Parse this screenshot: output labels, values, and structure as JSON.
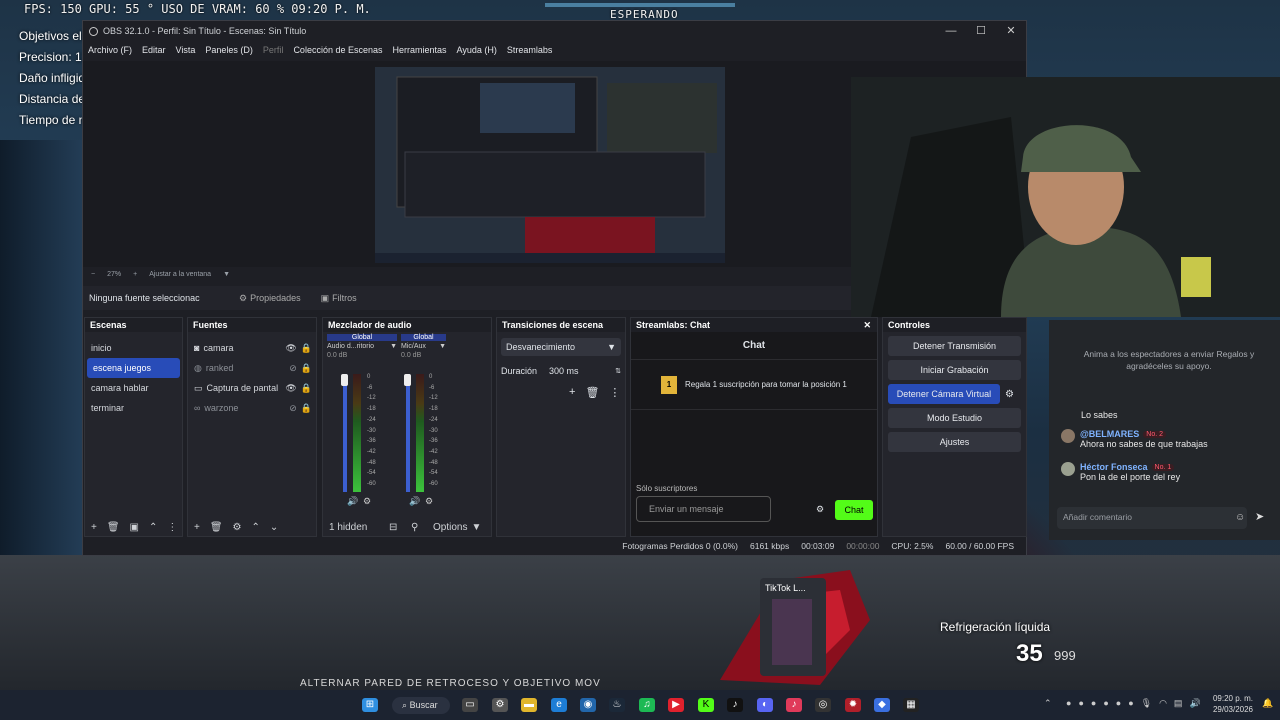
{
  "hud": {
    "stats": "FPS: 150  GPU: 55 °  USO DE VRAM: 60 %  09:20 P. M.",
    "status": "ESPERANDO",
    "objectives": [
      "Objetivos elin",
      "Precision: 13.",
      "Daño infligido",
      "Distancia del",
      "Tiempo de m"
    ],
    "weapon_label": "Refrigeración líquida",
    "ammo": "35",
    "ammo_reserve": "999",
    "hint": "ALTERNAR PARED DE RETROCESO Y OBJETIVO MÓVIL"
  },
  "obs": {
    "title": "OBS 32.1.0 - Perfil: Sin Título - Escenas: Sin Título",
    "menu": [
      "Archivo (F)",
      "Editar",
      "Vista",
      "Paneles (D)",
      "Perfil",
      "Colección de Escenas",
      "Herramientas",
      "Ayuda (H)",
      "Streamlabs"
    ],
    "zoom": "27%",
    "zoom_fit": "Ajustar a la ventana",
    "no_source": "Ninguna fuente seleccionac",
    "properties": "Propiedades",
    "filters": "Filtros",
    "scenes": {
      "title": "Escenas",
      "items": [
        "inicio",
        "escena juegos",
        "camara hablar",
        "terminar"
      ],
      "selected": 1
    },
    "sources": {
      "title": "Fuentes",
      "items": [
        {
          "label": "camara",
          "enabled": true
        },
        {
          "label": "ranked",
          "enabled": false
        },
        {
          "label": "Captura de pantal",
          "enabled": true
        },
        {
          "label": "warzone",
          "enabled": false
        }
      ]
    },
    "mixer": {
      "title": "Mezclador de audio",
      "channels": [
        {
          "label": "Global",
          "name": "Audio d...ritorio",
          "db": "0.0 dB"
        },
        {
          "label": "Global",
          "name": "Mic/Aux",
          "db": "0.0 dB"
        }
      ],
      "scale": [
        "0",
        "-6",
        "-12",
        "-18",
        "-24",
        "-30",
        "-36",
        "-42",
        "-48",
        "-54",
        "-60"
      ],
      "hidden": "1 hidden",
      "options": "Options"
    },
    "transitions": {
      "title": "Transiciones de escena",
      "type": "Desvanecimiento",
      "duration_label": "Duración",
      "duration_value": "300 ms"
    },
    "chat": {
      "title": "Streamlabs: Chat",
      "header": "Chat",
      "gift_badge": "1",
      "gift_text": "Regala 1 suscripción para tomar la posición 1",
      "subs_only": "Sólo suscriptores",
      "placeholder": "Enviar un mensaje",
      "send": "Chat"
    },
    "controls": {
      "title": "Controles",
      "buttons": [
        "Detener Transmisión",
        "Iniciar Grabación",
        "Detener Cámara Virtual",
        "Modo Estudio",
        "Ajustes"
      ]
    },
    "status": {
      "dropped": "Fotogramas Perdidos 0 (0.0%)",
      "bitrate": "6161 kbps",
      "stream_time": "00:03:09",
      "rec_time": "00:00:00",
      "cpu": "CPU: 2.5%",
      "fps": "60.00 / 60.00 FPS"
    }
  },
  "tiktok_chat": {
    "invite": "Anima a los espectadores a enviar Regalos y agradéceles su apoyo.",
    "messages": [
      {
        "user": "",
        "badge": "",
        "text": "Lo sabes"
      },
      {
        "user": "@BELMARES",
        "badge": "No. 2",
        "text": "Ahora no sabes de que trabajas"
      },
      {
        "user": "Héctor Fonseca",
        "badge": "No. 1",
        "text": "Pon la de el porte del rey"
      }
    ],
    "placeholder": "Añadir comentario"
  },
  "taskbar": {
    "search": "Buscar",
    "popup": "TikTok L...",
    "time": "09:20 p. m.",
    "date": "29/03/2026"
  },
  "colors": {
    "accent": "#284cb8",
    "chat_send": "#53fc18",
    "tiktok_badge": "#ff5a6e"
  }
}
